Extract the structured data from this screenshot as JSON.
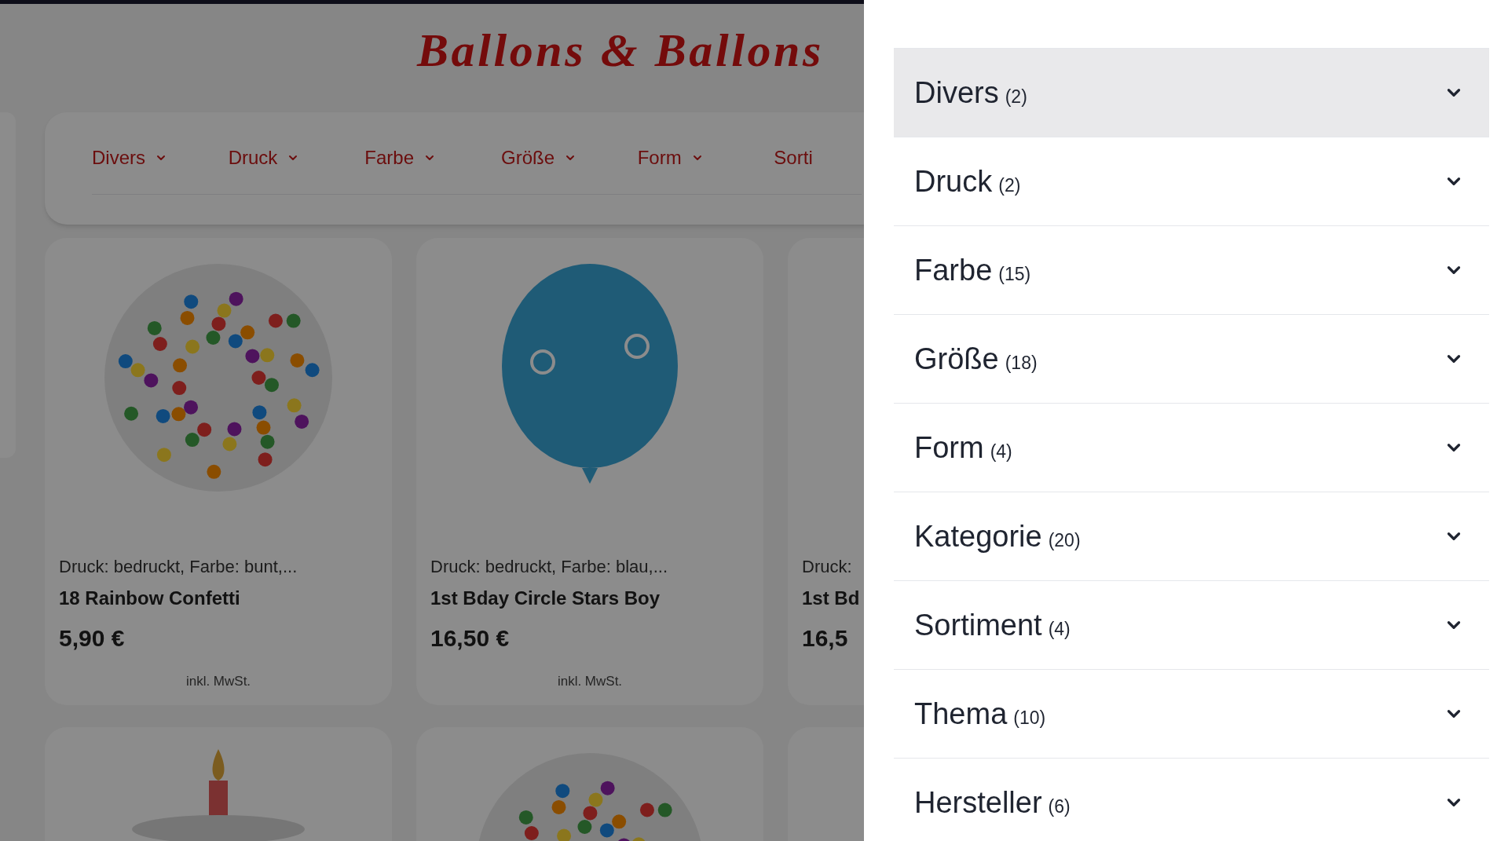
{
  "shop": {
    "logo": "Ballons & Ballons",
    "nav": [
      {
        "label": "Divers",
        "has_caret": true
      },
      {
        "label": "Druck",
        "has_caret": true
      },
      {
        "label": "Farbe",
        "has_caret": true
      },
      {
        "label": "Größe",
        "has_caret": true
      },
      {
        "label": "Form",
        "has_caret": true
      },
      {
        "label": "Sorti",
        "has_caret": false
      }
    ],
    "products": [
      {
        "description": "Druck: bedruckt, Farbe: bunt,...",
        "name": "18 Rainbow Confetti",
        "price": "5,90 €",
        "vat_note": "inkl. MwSt.",
        "kind": "foil"
      },
      {
        "description": "Druck: bedruckt, Farbe: blau,...",
        "name": "1st Bday Circle Stars Boy",
        "price": "16,50 €",
        "vat_note": "inkl. MwSt.",
        "kind": "latex"
      },
      {
        "description": "Druck:",
        "name": "1st Bd",
        "price": "16,5",
        "kind": "cut"
      },
      {
        "kind": "cake"
      },
      {
        "kind": "foil"
      },
      {
        "kind": "cut"
      }
    ]
  },
  "drawer": {
    "filters": [
      {
        "label": "Divers",
        "count": "(2)",
        "selected": true
      },
      {
        "label": "Druck",
        "count": "(2)",
        "selected": false
      },
      {
        "label": "Farbe",
        "count": "(15)",
        "selected": false
      },
      {
        "label": "Größe",
        "count": "(18)",
        "selected": false
      },
      {
        "label": "Form",
        "count": "(4)",
        "selected": false
      },
      {
        "label": "Kategorie",
        "count": "(20)",
        "selected": false
      },
      {
        "label": "Sortiment",
        "count": "(4)",
        "selected": false
      },
      {
        "label": "Thema",
        "count": "(10)",
        "selected": false
      },
      {
        "label": "Hersteller",
        "count": "(6)",
        "selected": false
      }
    ]
  }
}
